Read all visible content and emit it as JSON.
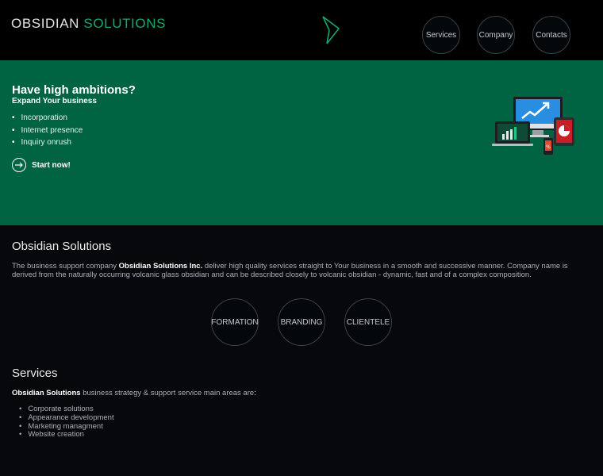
{
  "header": {
    "logo_word1": "OBSIDIAN",
    "logo_word2": "SOLUTIONS",
    "nav": [
      "Services",
      "Company",
      "Contacts"
    ]
  },
  "hero": {
    "title": "Have high ambitions?",
    "subtitle": "Expand Your business",
    "bullets": [
      "Incorporation",
      "Internet presence",
      "Inquiry onrush"
    ],
    "cta": "Start now!"
  },
  "about": {
    "title": "Obsidian Solutions",
    "para_prefix": "The business support company ",
    "para_company": "Obsidian Solutions Inc.",
    "para_suffix": " deliver high quality services straight to Your business in a smooth and successive manner. Company name is derived from the naturally occurring volcanic glass obsidian and can be described closely to volcanic obsidian - dynamic, fast and of a complex composition."
  },
  "features": [
    "FORMATION",
    "BRANDING",
    "CLIENTELE"
  ],
  "services": {
    "title": "Services",
    "intro_bold": "Obsidian Solutions",
    "intro_rest": " business strategy & support service main areas are:",
    "items": [
      "Corporate solutions",
      "Appearance development",
      "Marketing managment",
      "Website creation"
    ]
  },
  "colors": {
    "accent": "#17a873",
    "hero_bg": "#006442",
    "page_bg": "#06080b"
  },
  "icons": [
    "triangle-emblem-icon",
    "arrow-right-icon",
    "devices-illustration"
  ]
}
